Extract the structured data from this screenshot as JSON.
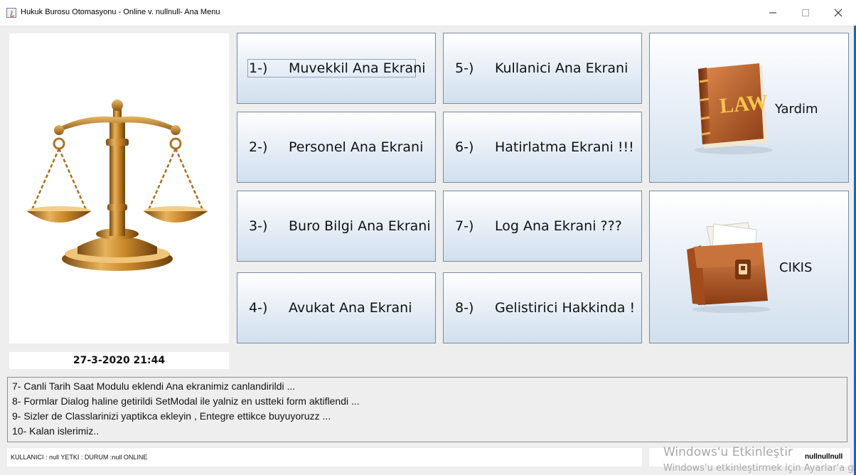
{
  "window": {
    "title": "Hukuk Burosu Otomasyonu - Online v. nullnull- Ana Menu",
    "minimize_icon": "minimize-icon",
    "maximize_icon": "maximize-icon",
    "close_icon": "close-icon"
  },
  "menu": {
    "buttons": [
      {
        "num": "1-)",
        "label": "Muvekkil Ana Ekrani"
      },
      {
        "num": "2-)",
        "label": "Personel Ana Ekrani"
      },
      {
        "num": "3-)",
        "label": "Buro Bilgi Ana Ekrani"
      },
      {
        "num": "4-)",
        "label": "Avukat Ana Ekrani"
      },
      {
        "num": "5-)",
        "label": "Kullanici Ana Ekrani"
      },
      {
        "num": "6-)",
        "label": "Hatirlatma Ekrani !!!"
      },
      {
        "num": "7-)",
        "label": "Log Ana Ekrani ???"
      },
      {
        "num": "8-)",
        "label": "Gelistirici Hakkinda !"
      }
    ],
    "help": {
      "label": "Yardim",
      "icon": "law-book-icon",
      "book_text": "LAW"
    },
    "exit": {
      "label": "CIKIS",
      "icon": "briefcase-icon"
    }
  },
  "logo": {
    "icon": "scales-of-justice-icon"
  },
  "datetime": "27-3-2020 21:44",
  "notes": [
    "7- Canli Tarih Saat Modulu eklendi Ana ekranimiz canlandirildi ...",
    "8- Formlar Dialog haline getirildi SetModal ile yalniz en ustteki form aktiflendi ...",
    "9- Sizler de Classlarinizi yaptikca ekleyin , Entegre ettikce buyuyoruzz ...",
    "10- Kalan islerimiz.."
  ],
  "status": {
    "left": "KULLANICI : null YETKI : DURUM :null  ONLINE",
    "user": "nullnullnull"
  },
  "watermark": {
    "line1": "Windows'u Etkinleştir",
    "line2": "Windows'u etkinleştirmek için Ayarlar'a gidin."
  },
  "colors": {
    "frame_accent": "#1565c0",
    "button_gradient_top": "#ffffff",
    "button_gradient_bottom": "#d1dfee",
    "gold": "#c8862a",
    "leather": "#b5622c"
  }
}
